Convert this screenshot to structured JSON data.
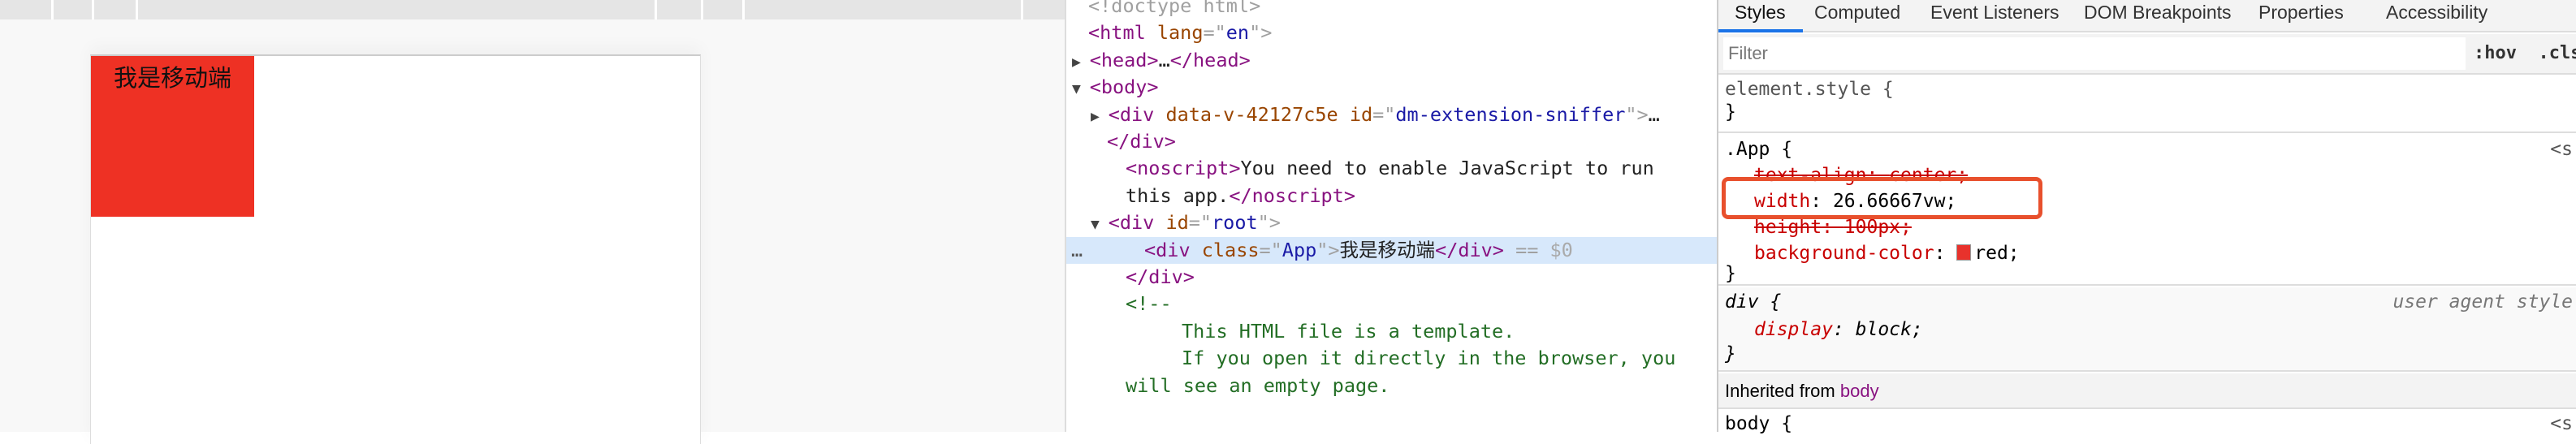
{
  "viewport": {
    "app_text": "我是移动端",
    "app_color": "#ee3124"
  },
  "elements": {
    "lines": [
      {
        "indent": 1,
        "parts": [
          [
            "br",
            "<!doctype html>"
          ]
        ]
      },
      {
        "indent": 1,
        "parts": [
          [
            "tg",
            "<html "
          ],
          [
            "at",
            "lang"
          ],
          [
            "br",
            "=\""
          ],
          [
            "av",
            "en"
          ],
          [
            "br",
            "\">"
          ]
        ]
      },
      {
        "indent": 1,
        "tri": "▶",
        "parts": [
          [
            "tg",
            "<head>"
          ],
          [
            "",
            "…"
          ],
          [
            "tg",
            "</head>"
          ]
        ]
      },
      {
        "indent": 1,
        "tri": "▼",
        "parts": [
          [
            "tg",
            "<body>"
          ]
        ]
      },
      {
        "indent": 2,
        "tri": "▶",
        "parts": [
          [
            "tg",
            "<div "
          ],
          [
            "at",
            "data-v-42127c5e "
          ],
          [
            "at",
            "id"
          ],
          [
            "br",
            "=\""
          ],
          [
            "av",
            "dm-extension-sniffer"
          ],
          [
            "br",
            "\">"
          ],
          [
            "",
            "…"
          ]
        ]
      },
      {
        "indent": 2,
        "parts": [
          [
            "tg",
            "</div>"
          ]
        ]
      },
      {
        "indent": 3,
        "parts": [
          [
            "tg",
            "<noscript>"
          ],
          [
            "",
            "You need to enable JavaScript to run"
          ]
        ]
      },
      {
        "indent": 3,
        "parts": [
          [
            "",
            "this app."
          ],
          [
            "tg",
            "</noscript>"
          ]
        ]
      },
      {
        "indent": 2,
        "tri": "▼",
        "parts": [
          [
            "tg",
            "<div "
          ],
          [
            "at",
            "id"
          ],
          [
            "br",
            "=\""
          ],
          [
            "av",
            "root"
          ],
          [
            "br",
            "\">"
          ]
        ]
      },
      {
        "indent": 4,
        "selected": true,
        "parts": [
          [
            "tg",
            "<div "
          ],
          [
            "at",
            "class"
          ],
          [
            "br",
            "=\""
          ],
          [
            "av",
            "App"
          ],
          [
            "br",
            "\">"
          ],
          [
            "",
            "我是移动端"
          ],
          [
            "tg",
            "</div>"
          ],
          [
            "br",
            " == "
          ],
          [
            "dim",
            "$0"
          ]
        ]
      },
      {
        "indent": 3,
        "parts": [
          [
            "tg",
            "</div>"
          ]
        ]
      },
      {
        "indent": 3,
        "parts": [
          [
            "cm",
            "<!--"
          ]
        ]
      },
      {
        "indent": 6,
        "parts": [
          [
            "cm",
            "This HTML file is a template."
          ]
        ]
      },
      {
        "indent": 6,
        "parts": [
          [
            "cm",
            "If you open it directly in the browser, you"
          ]
        ]
      },
      {
        "indent": 3,
        "parts": [
          [
            "cm",
            "will see an empty page."
          ]
        ]
      },
      {
        "indent": 1,
        "parts": [
          [
            "cm",
            ""
          ]
        ]
      }
    ],
    "selected_marker": "…"
  },
  "styles": {
    "tabs": [
      "Styles",
      "Computed",
      "Event Listeners",
      "DOM Breakpoints",
      "Properties",
      "Accessibility"
    ],
    "active_tab": "Styles",
    "filter_placeholder": "Filter",
    "hov": ":hov",
    "cls": ".cls",
    "element_style": {
      "selector": "element.style {",
      "close": "}"
    },
    "app_rule": {
      "selector": ".App {",
      "source": "<s",
      "decls": [
        {
          "prop": "text-align",
          "value": "center;",
          "overridden": true
        },
        {
          "prop": "width",
          "value": "26.66667vw;",
          "highlighted": true
        },
        {
          "prop": "height",
          "value": "100px;",
          "overridden": true
        },
        {
          "prop": "background-color",
          "value": "red;",
          "swatch": "#e8322c"
        }
      ],
      "close": "}"
    },
    "div_rule": {
      "selector": "div {",
      "source": "user agent style",
      "prop": "display",
      "value": "block;",
      "close": "}"
    },
    "inherited_label": "Inherited from",
    "inherited_from": "body",
    "body_rule": {
      "selector": "body {",
      "source": "<s"
    },
    "highlight_color": "#e8502d"
  }
}
